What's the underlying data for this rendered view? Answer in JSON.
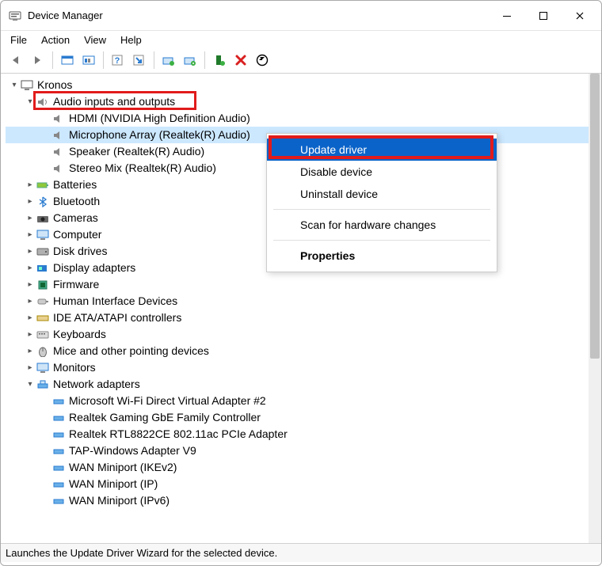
{
  "window": {
    "title": "Device Manager"
  },
  "menu": {
    "file": "File",
    "action": "Action",
    "view": "View",
    "help": "Help"
  },
  "tree": {
    "root": "Kronos",
    "audio": {
      "label": "Audio inputs and outputs",
      "items": [
        "HDMI (NVIDIA High Definition Audio)",
        "Microphone Array (Realtek(R) Audio)",
        "Speaker (Realtek(R) Audio)",
        "Stereo Mix (Realtek(R) Audio)"
      ]
    },
    "batteries": "Batteries",
    "bluetooth": "Bluetooth",
    "cameras": "Cameras",
    "computer": "Computer",
    "disk": "Disk drives",
    "display": "Display adapters",
    "firmware": "Firmware",
    "hid": "Human Interface Devices",
    "ide": "IDE ATA/ATAPI controllers",
    "keyboards": "Keyboards",
    "mice": "Mice and other pointing devices",
    "monitors": "Monitors",
    "network": {
      "label": "Network adapters",
      "items": [
        "Microsoft Wi-Fi Direct Virtual Adapter #2",
        "Realtek Gaming GbE Family Controller",
        "Realtek RTL8822CE 802.11ac PCIe Adapter",
        "TAP-Windows Adapter V9",
        "WAN Miniport (IKEv2)",
        "WAN Miniport (IP)",
        "WAN Miniport (IPv6)"
      ]
    }
  },
  "ctx": {
    "update": "Update driver",
    "disable": "Disable device",
    "uninstall": "Uninstall device",
    "scan": "Scan for hardware changes",
    "properties": "Properties"
  },
  "status": "Launches the Update Driver Wizard for the selected device."
}
